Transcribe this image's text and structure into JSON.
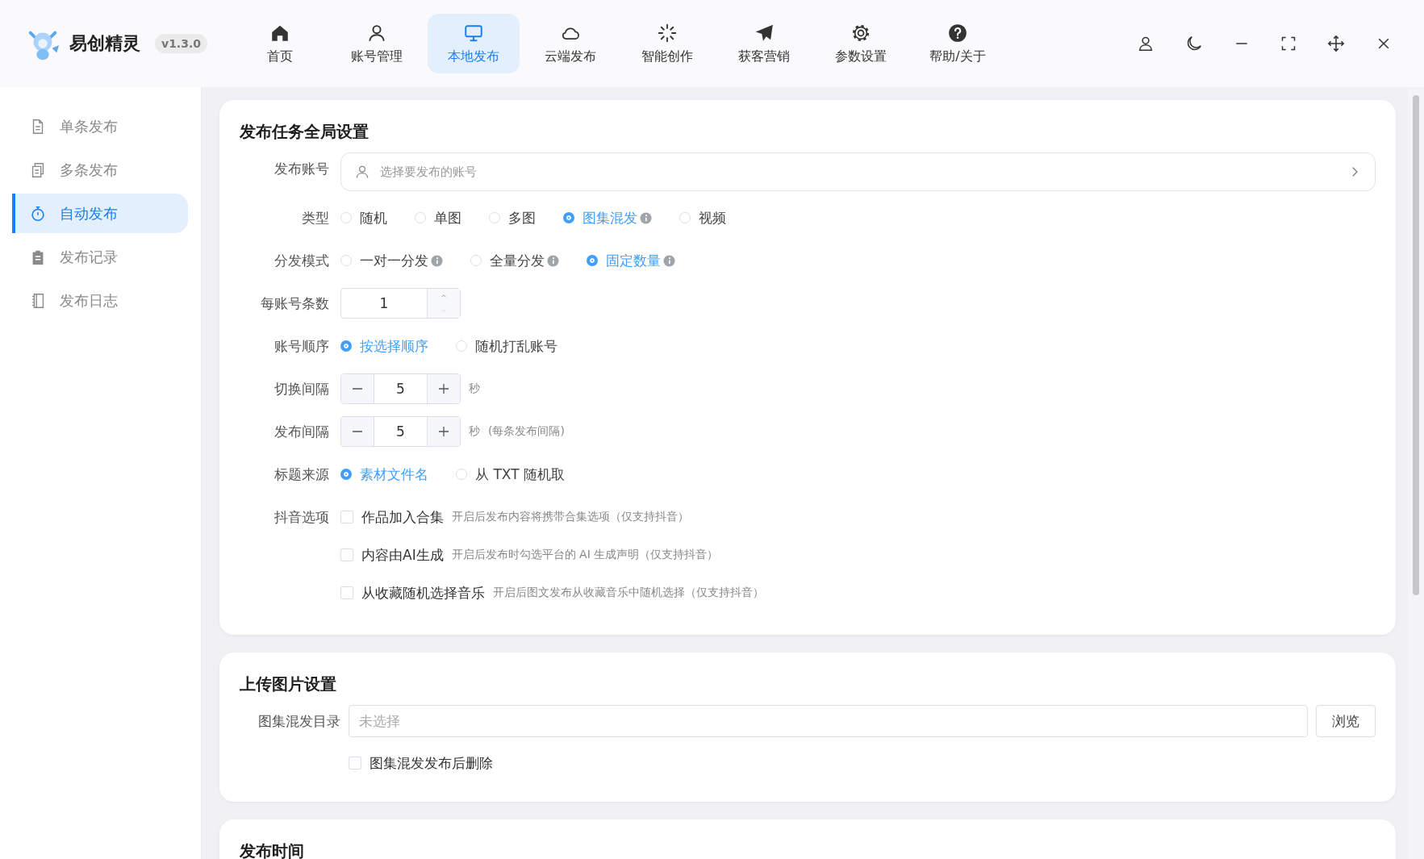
{
  "app": {
    "name": "易创精灵",
    "version": "v1.3.0"
  },
  "nav": [
    {
      "label": "首页",
      "selected": false
    },
    {
      "label": "账号管理",
      "selected": false
    },
    {
      "label": "本地发布",
      "selected": true
    },
    {
      "label": "云端发布",
      "selected": false
    },
    {
      "label": "智能创作",
      "selected": false
    },
    {
      "label": "获客营销",
      "selected": false
    },
    {
      "label": "参数设置",
      "selected": false
    },
    {
      "label": "帮助/关于",
      "selected": false
    }
  ],
  "sidebar": {
    "items": [
      {
        "label": "单条发布",
        "selected": false
      },
      {
        "label": "多条发布",
        "selected": false
      },
      {
        "label": "自动发布",
        "selected": true
      },
      {
        "label": "发布记录",
        "selected": false
      },
      {
        "label": "发布日志",
        "selected": false
      }
    ]
  },
  "global_settings": {
    "title": "发布任务全局设置",
    "rows": [
      {
        "kind": "select",
        "label": "发布账号",
        "placeholder": "选择要发布的账号"
      },
      {
        "kind": "radio",
        "label": "类型",
        "options": [
          {
            "label": "随机",
            "selected": false,
            "info": false
          },
          {
            "label": "单图",
            "selected": false,
            "info": false
          },
          {
            "label": "多图",
            "selected": false,
            "info": false
          },
          {
            "label": "图集混发",
            "selected": true,
            "info": true
          },
          {
            "label": "视频",
            "selected": false,
            "info": false
          }
        ]
      },
      {
        "kind": "radio",
        "label": "分发模式",
        "options": [
          {
            "label": "一对一分发",
            "selected": false,
            "info": true
          },
          {
            "label": "全量分发",
            "selected": false,
            "info": true
          },
          {
            "label": "固定数量",
            "selected": true,
            "info": true
          }
        ]
      },
      {
        "kind": "number",
        "label": "每账号条数",
        "value": "1"
      },
      {
        "kind": "radio",
        "label": "账号顺序",
        "options": [
          {
            "label": "按选择顺序",
            "selected": true,
            "info": false
          },
          {
            "label": "随机打乱账号",
            "selected": false,
            "info": false
          }
        ]
      },
      {
        "kind": "stepper",
        "label": "切换间隔",
        "value": "5",
        "unit": "秒"
      },
      {
        "kind": "stepper",
        "label": "发布间隔",
        "value": "5",
        "unit": "秒",
        "note": "(每条发布间隔)"
      },
      {
        "kind": "radio",
        "label": "标题来源",
        "options": [
          {
            "label": "素材文件名",
            "selected": true,
            "info": false
          },
          {
            "label": "从 TXT 随机取",
            "selected": false,
            "info": false
          }
        ]
      },
      {
        "kind": "checks",
        "label": "抖音选项",
        "items": [
          {
            "label": "作品加入合集",
            "checked": false,
            "hint": "开启后发布内容将携带合集选项（仅支持抖音）"
          },
          {
            "label": "内容由AI生成",
            "checked": false,
            "hint": "开启后发布时勾选平台的 AI 生成声明（仅支持抖音）"
          },
          {
            "label": "从收藏随机选择音乐",
            "checked": false,
            "hint": "开启后图文发布从收藏音乐中随机选择（仅支持抖音）"
          }
        ]
      }
    ]
  },
  "upload_settings": {
    "title": "上传图片设置",
    "label": "图集混发目录",
    "placeholder": "未选择",
    "button": "浏览",
    "delete_after": {
      "label": "图集混发发布后删除",
      "checked": false
    }
  },
  "publish_time": {
    "title": "发布时间"
  }
}
